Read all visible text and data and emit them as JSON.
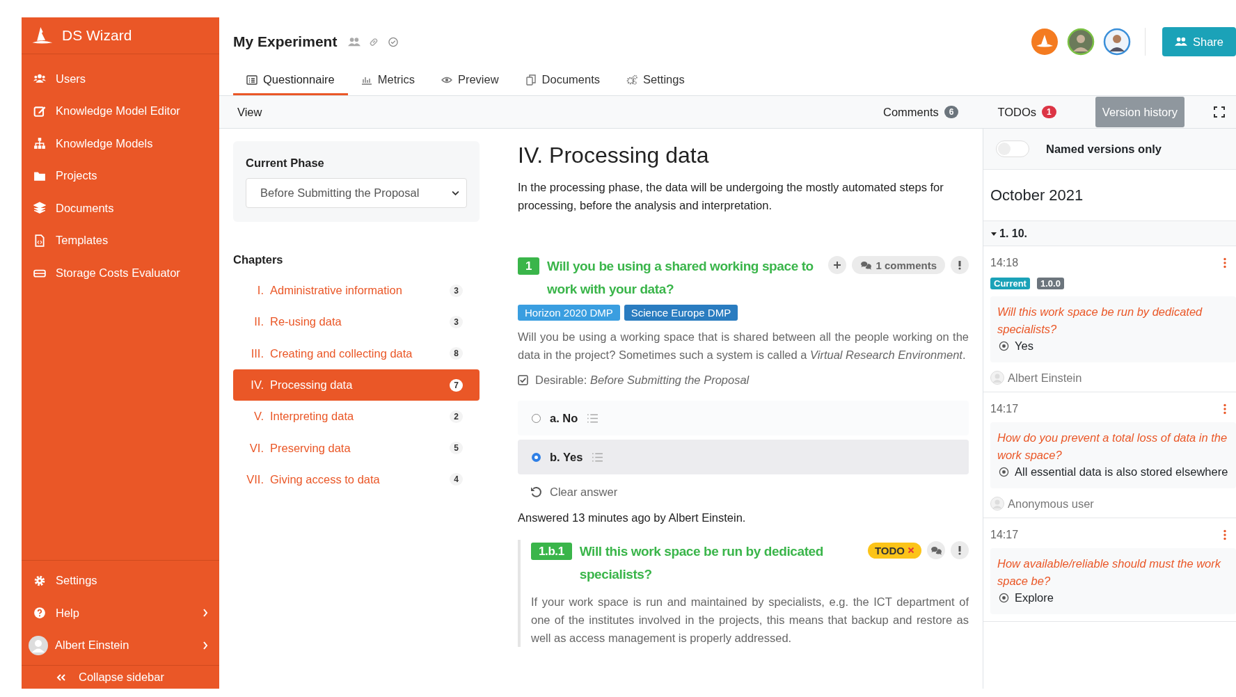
{
  "sidebar": {
    "brand": "DS Wizard",
    "items": [
      {
        "label": "Users",
        "selected": false
      },
      {
        "label": "Knowledge Model Editor",
        "selected": false
      },
      {
        "label": "Knowledge Models",
        "selected": false
      },
      {
        "label": "Projects",
        "selected": false
      },
      {
        "label": "Documents",
        "selected": false
      },
      {
        "label": "Templates",
        "selected": false
      },
      {
        "label": "Storage Costs Evaluator",
        "selected": false
      }
    ],
    "bottom_items": [
      {
        "label": "Settings",
        "kind": "settings"
      },
      {
        "label": "Help",
        "kind": "help"
      },
      {
        "label": "Albert Einstein",
        "kind": "profile"
      }
    ],
    "collapse": "Collapse sidebar"
  },
  "header": {
    "title": "My Experiment",
    "share": "Share"
  },
  "tabs": [
    {
      "label": "Questionnaire",
      "selected": true
    },
    {
      "label": "Metrics",
      "selected": false
    },
    {
      "label": "Preview",
      "selected": false
    },
    {
      "label": "Documents",
      "selected": false
    },
    {
      "label": "Settings",
      "selected": false
    }
  ],
  "toolbar": {
    "view": "View",
    "comments": {
      "label": "Comments",
      "count": "6"
    },
    "todos": {
      "label": "TODOs",
      "count": "1"
    },
    "version_history": {
      "label": "Version history",
      "selected": true
    }
  },
  "phase": {
    "label": "Current Phase",
    "value": "Before Submitting the Proposal"
  },
  "chapters": {
    "title": "Chapters",
    "items": [
      {
        "number": "I.",
        "title": "Administrative information",
        "count": "3",
        "selected": false
      },
      {
        "number": "II.",
        "title": "Re-using data",
        "count": "3",
        "selected": false
      },
      {
        "number": "III.",
        "title": "Creating and collecting data",
        "count": "8",
        "selected": false
      },
      {
        "number": "IV.",
        "title": "Processing data",
        "count": "7",
        "selected": true
      },
      {
        "number": "V.",
        "title": "Interpreting data",
        "count": "2",
        "selected": false
      },
      {
        "number": "VI.",
        "title": "Preserving data",
        "count": "5",
        "selected": false
      },
      {
        "number": "VII.",
        "title": "Giving access to data",
        "count": "4",
        "selected": false
      }
    ]
  },
  "content": {
    "title": "IV. Processing data",
    "intro": "In the processing phase, the data will be undergoing the mostly automated steps for processing, before the analysis and interpretation.",
    "question": {
      "number": "1",
      "title": "Will you be using a shared working space to work with your data?",
      "comments": "1 comments",
      "tags": [
        {
          "label": "Horizon 2020 DMP",
          "color": "#3a9ee0"
        },
        {
          "label": "Science Europe DMP",
          "color": "#2a7cc0"
        }
      ],
      "description": "Will you be using a working space that is shared between all the people working on the data in the project? Sometimes such a system is called a *Virtual Research Environment*.",
      "desirable": {
        "checked": true,
        "text": "Desirable: *Before Submitting the Proposal*"
      },
      "options": [
        {
          "label": "a. No",
          "selected": false
        },
        {
          "label": "b. Yes",
          "selected": true
        }
      ],
      "clear": "Clear answer",
      "answered": "Answered 13 minutes ago by Albert Einstein."
    },
    "followup": {
      "number": "1.b.1",
      "title": "Will this work space be run by dedicated specialists?",
      "todo": "TODO",
      "description": "If your work space is run and maintained by specialists, e.g. the ICT department of one of the institutes involved in the projects, this means that backup and restore as well as access management is properly addressed."
    }
  },
  "history": {
    "named_only": {
      "label": "Named versions only",
      "on": false
    },
    "month": "October 2021",
    "day": {
      "label": "1. 10.",
      "expanded": true
    },
    "entries": [
      {
        "time": "14:18",
        "tags": [
          {
            "label": "Current",
            "kind": "current"
          },
          {
            "label": "1.0.0",
            "kind": "version"
          }
        ],
        "question": "Will this work space be run by dedicated specialists?",
        "answer": "Yes",
        "user": "Albert Einstein"
      },
      {
        "time": "14:17",
        "question": "How do you prevent a total loss of data in the work space?",
        "answer": "All essential data is also stored elsewhere",
        "user": "Anonymous user"
      },
      {
        "time": "14:17",
        "question": "How available/reliable should must the work space be?",
        "answer": "Explore"
      }
    ]
  }
}
